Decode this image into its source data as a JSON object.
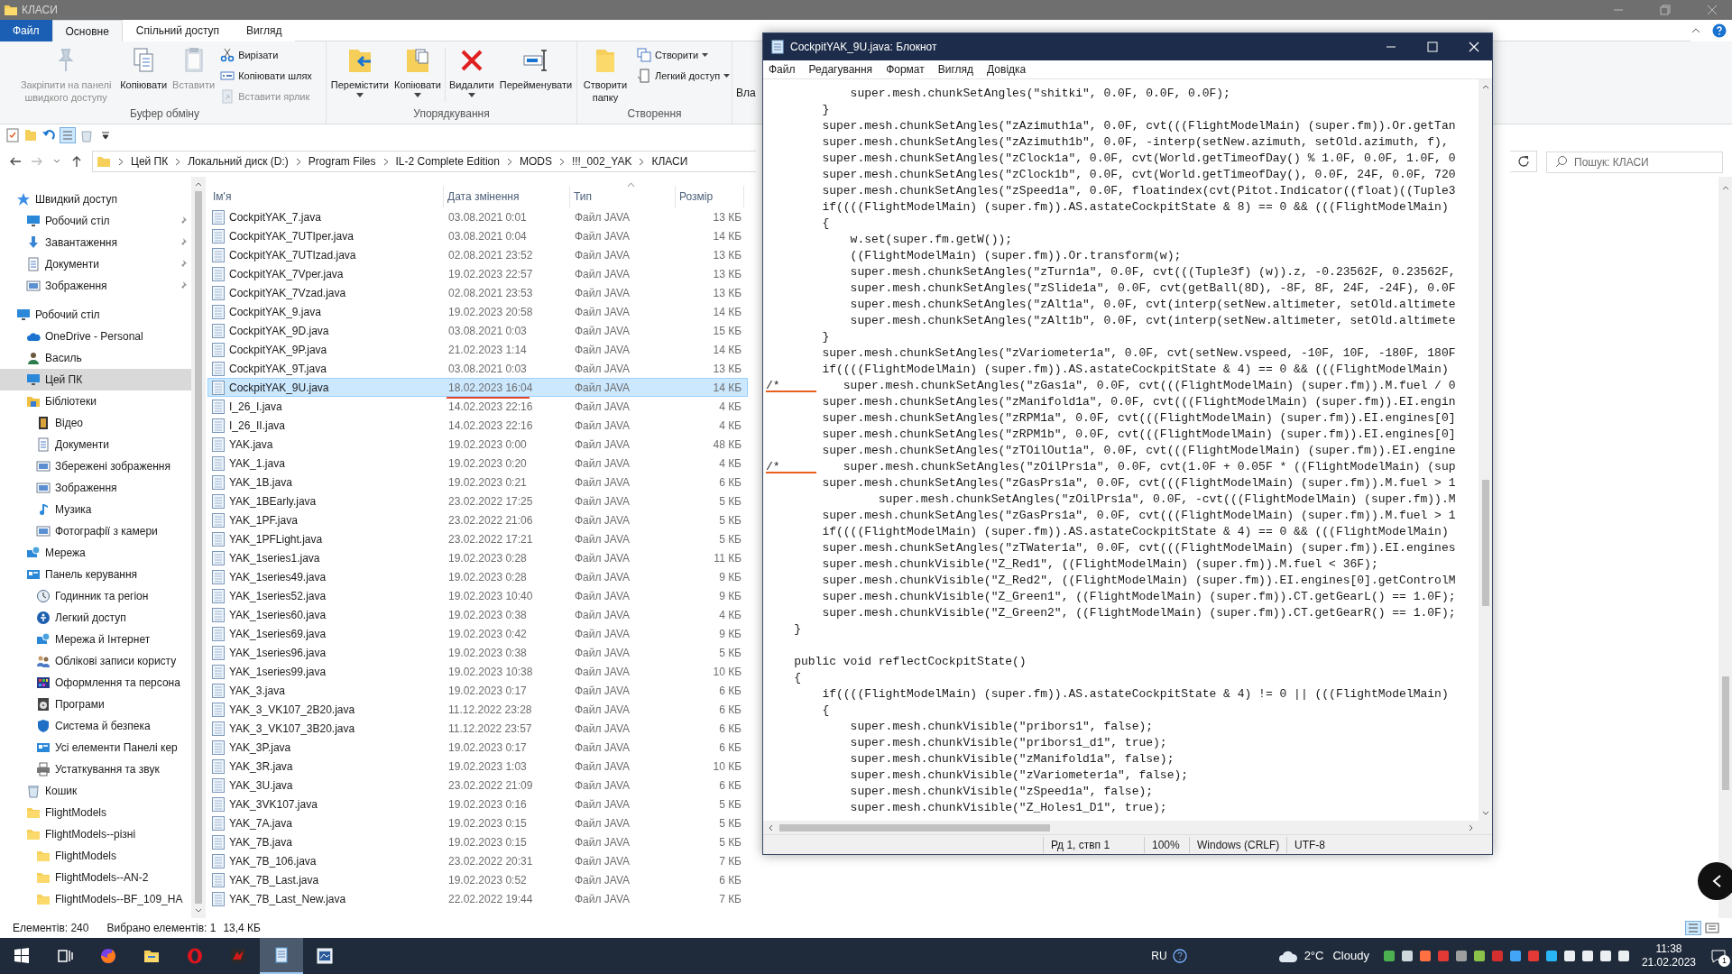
{
  "explorer": {
    "title": "КЛАСИ",
    "tabs": [
      {
        "label": "Файл",
        "kind": "file",
        "selected": false
      },
      {
        "label": "Основне",
        "kind": "tab",
        "selected": true
      },
      {
        "label": "Спільний доступ",
        "kind": "tab",
        "selected": false
      },
      {
        "label": "Вигляд",
        "kind": "tab",
        "selected": false
      }
    ],
    "ribbon": [
      {
        "label": "Буфер обміну",
        "large": [
          {
            "label": "Закріпити на панелі швидкого доступу",
            "disabled": true,
            "dropdown": false
          },
          {
            "label": "Копіювати",
            "disabled": false,
            "dropdown": false
          },
          {
            "label": "Вставити",
            "disabled": true,
            "dropdown": false
          }
        ],
        "small": [
          {
            "label": "Вирізати",
            "disabled": false,
            "dropdown": false
          },
          {
            "label": "Копіювати шлях",
            "disabled": false,
            "dropdown": false
          },
          {
            "label": "Вставити ярлик",
            "disabled": true,
            "dropdown": false
          }
        ]
      },
      {
        "label": "Упорядкування",
        "large": [
          {
            "label": "Перемістити",
            "disabled": false,
            "dropdown": true
          },
          {
            "label": "Копіювати",
            "disabled": false,
            "dropdown": true
          },
          {
            "label": "Видалити",
            "disabled": false,
            "dropdown": true
          },
          {
            "label": "Перейменувати",
            "disabled": false,
            "dropdown": false
          }
        ]
      },
      {
        "label": "Створення",
        "large": [
          {
            "label": "Створити папку",
            "disabled": false,
            "dropdown": false
          }
        ],
        "small": [
          {
            "label": "Створити",
            "disabled": false,
            "dropdown": true
          },
          {
            "label": "Легкий доступ",
            "disabled": false,
            "dropdown": true
          }
        ]
      }
    ],
    "ribbon_clipped_label": "Вла",
    "breadcrumbs": [
      "Цей ПК",
      "Локальний диск (D:)",
      "Program Files",
      "IL-2 Complete Edition",
      "MODS",
      "!!!_002_YAK",
      "КЛАСИ"
    ],
    "search": {
      "placeholder": "Пошук: КЛАСИ"
    },
    "sidebar": [
      {
        "label": "Швидкий доступ",
        "selected": false,
        "children": [
          {
            "label": "Робочий стіл",
            "selected": false,
            "pinned": true
          },
          {
            "label": "Завантаження",
            "selected": false,
            "pinned": true
          },
          {
            "label": "Документи",
            "selected": false,
            "pinned": true
          },
          {
            "label": "Зображення",
            "selected": false,
            "pinned": true
          }
        ]
      },
      {
        "label": "Робочий стіл",
        "selected": false,
        "children": [
          {
            "label": "OneDrive - Personal",
            "selected": false
          },
          {
            "label": "Василь",
            "selected": false
          },
          {
            "label": "Цей ПК",
            "selected": true
          },
          {
            "label": "Бібліотеки",
            "selected": false,
            "children": [
              {
                "label": "Відео",
                "selected": false
              },
              {
                "label": "Документи",
                "selected": false
              },
              {
                "label": "Збережені зображення",
                "selected": false
              },
              {
                "label": "Зображення",
                "selected": false
              },
              {
                "label": "Музика",
                "selected": false
              },
              {
                "label": "Фотографії з камери",
                "selected": false
              }
            ]
          },
          {
            "label": "Мережа",
            "selected": false
          },
          {
            "label": "Панель керування",
            "selected": false,
            "children": [
              {
                "label": "Годинник та регіон",
                "selected": false
              },
              {
                "label": "Легкий доступ",
                "selected": false
              },
              {
                "label": "Мережа й Інтернет",
                "selected": false
              },
              {
                "label": "Облікові записи користу",
                "selected": false
              },
              {
                "label": "Оформлення та персона",
                "selected": false
              },
              {
                "label": "Програми",
                "selected": false
              },
              {
                "label": "Система й безпека",
                "selected": false
              },
              {
                "label": "Усі елементи Панелі кер",
                "selected": false
              },
              {
                "label": "Устаткування та звук",
                "selected": false
              }
            ]
          },
          {
            "label": "Кошик",
            "selected": false
          },
          {
            "label": "FlightModels",
            "selected": false
          },
          {
            "label": "FlightModels--різні",
            "selected": false,
            "children": [
              {
                "label": "FlightModels",
                "selected": false
              },
              {
                "label": "FlightModels--AN-2",
                "selected": false
              },
              {
                "label": "FlightModels--BF_109_HA",
                "selected": false
              }
            ]
          }
        ]
      }
    ],
    "columns": [
      "Ім'я",
      "Дата змінення",
      "Тип",
      "Розмір"
    ],
    "files": [
      {
        "name": "CockpitYAK_7.java",
        "modified": "03.08.2021 0:01",
        "type": "Файл JAVA",
        "size": "13 КБ",
        "selected": false,
        "underlined": false
      },
      {
        "name": "CockpitYAK_7UTIper.java",
        "modified": "03.08.2021 0:04",
        "type": "Файл JAVA",
        "size": "14 КБ",
        "selected": false,
        "underlined": false
      },
      {
        "name": "CockpitYAK_7UTIzad.java",
        "modified": "02.08.2021 23:52",
        "type": "Файл JAVA",
        "size": "13 КБ",
        "selected": false,
        "underlined": false
      },
      {
        "name": "CockpitYAK_7Vper.java",
        "modified": "19.02.2023 22:57",
        "type": "Файл JAVA",
        "size": "13 КБ",
        "selected": false,
        "underlined": false
      },
      {
        "name": "CockpitYAK_7Vzad.java",
        "modified": "02.08.2021 23:53",
        "type": "Файл JAVA",
        "size": "13 КБ",
        "selected": false,
        "underlined": false
      },
      {
        "name": "CockpitYAK_9.java",
        "modified": "19.02.2023 20:58",
        "type": "Файл JAVA",
        "size": "14 КБ",
        "selected": false,
        "underlined": false
      },
      {
        "name": "CockpitYAK_9D.java",
        "modified": "03.08.2021 0:03",
        "type": "Файл JAVA",
        "size": "15 КБ",
        "selected": false,
        "underlined": false
      },
      {
        "name": "CockpitYAK_9P.java",
        "modified": "21.02.2023 1:14",
        "type": "Файл JAVA",
        "size": "14 КБ",
        "selected": false,
        "underlined": false
      },
      {
        "name": "CockpitYAK_9T.java",
        "modified": "03.08.2021 0:03",
        "type": "Файл JAVA",
        "size": "13 КБ",
        "selected": false,
        "underlined": false
      },
      {
        "name": "CockpitYAK_9U.java",
        "modified": "18.02.2023 16:04",
        "type": "Файл JAVA",
        "size": "14 КБ",
        "selected": true,
        "underlined": true
      },
      {
        "name": "I_26_I.java",
        "modified": "14.02.2023 22:16",
        "type": "Файл JAVA",
        "size": "4 КБ",
        "selected": false,
        "underlined": false
      },
      {
        "name": "I_26_II.java",
        "modified": "14.02.2023 22:16",
        "type": "Файл JAVA",
        "size": "4 КБ",
        "selected": false,
        "underlined": false
      },
      {
        "name": "YAK.java",
        "modified": "19.02.2023 0:00",
        "type": "Файл JAVA",
        "size": "48 КБ",
        "selected": false,
        "underlined": false
      },
      {
        "name": "YAK_1.java",
        "modified": "19.02.2023 0:20",
        "type": "Файл JAVA",
        "size": "4 КБ",
        "selected": false,
        "underlined": false
      },
      {
        "name": "YAK_1B.java",
        "modified": "19.02.2023 0:21",
        "type": "Файл JAVA",
        "size": "6 КБ",
        "selected": false,
        "underlined": false
      },
      {
        "name": "YAK_1BEarly.java",
        "modified": "23.02.2022 17:25",
        "type": "Файл JAVA",
        "size": "5 КБ",
        "selected": false,
        "underlined": false
      },
      {
        "name": "YAK_1PF.java",
        "modified": "23.02.2022 21:06",
        "type": "Файл JAVA",
        "size": "5 КБ",
        "selected": false,
        "underlined": false
      },
      {
        "name": "YAK_1PFLight.java",
        "modified": "23.02.2022 17:21",
        "type": "Файл JAVA",
        "size": "5 КБ",
        "selected": false,
        "underlined": false
      },
      {
        "name": "YAK_1series1.java",
        "modified": "19.02.2023 0:28",
        "type": "Файл JAVA",
        "size": "11 КБ",
        "selected": false,
        "underlined": false
      },
      {
        "name": "YAK_1series49.java",
        "modified": "19.02.2023 0:28",
        "type": "Файл JAVA",
        "size": "9 КБ",
        "selected": false,
        "underlined": false
      },
      {
        "name": "YAK_1series52.java",
        "modified": "19.02.2023 10:40",
        "type": "Файл JAVA",
        "size": "9 КБ",
        "selected": false,
        "underlined": false
      },
      {
        "name": "YAK_1series60.java",
        "modified": "19.02.2023 0:38",
        "type": "Файл JAVA",
        "size": "4 КБ",
        "selected": false,
        "underlined": false
      },
      {
        "name": "YAK_1series69.java",
        "modified": "19.02.2023 0:42",
        "type": "Файл JAVA",
        "size": "9 КБ",
        "selected": false,
        "underlined": false
      },
      {
        "name": "YAK_1series96.java",
        "modified": "19.02.2023 0:38",
        "type": "Файл JAVA",
        "size": "5 КБ",
        "selected": false,
        "underlined": false
      },
      {
        "name": "YAK_1series99.java",
        "modified": "19.02.2023 10:38",
        "type": "Файл JAVA",
        "size": "10 КБ",
        "selected": false,
        "underlined": false
      },
      {
        "name": "YAK_3.java",
        "modified": "19.02.2023 0:17",
        "type": "Файл JAVA",
        "size": "6 КБ",
        "selected": false,
        "underlined": false
      },
      {
        "name": "YAK_3_VK107_2B20.java",
        "modified": "11.12.2022 23:28",
        "type": "Файл JAVA",
        "size": "6 КБ",
        "selected": false,
        "underlined": false
      },
      {
        "name": "YAK_3_VK107_3B20.java",
        "modified": "11.12.2022 23:57",
        "type": "Файл JAVA",
        "size": "6 КБ",
        "selected": false,
        "underlined": false
      },
      {
        "name": "YAK_3P.java",
        "modified": "19.02.2023 0:17",
        "type": "Файл JAVA",
        "size": "6 КБ",
        "selected": false,
        "underlined": false
      },
      {
        "name": "YAK_3R.java",
        "modified": "19.02.2023 1:03",
        "type": "Файл JAVA",
        "size": "10 КБ",
        "selected": false,
        "underlined": false
      },
      {
        "name": "YAK_3U.java",
        "modified": "23.02.2022 21:09",
        "type": "Файл JAVA",
        "size": "6 КБ",
        "selected": false,
        "underlined": false
      },
      {
        "name": "YAK_3VK107.java",
        "modified": "19.02.2023 0:16",
        "type": "Файл JAVA",
        "size": "5 КБ",
        "selected": false,
        "underlined": false
      },
      {
        "name": "YAK_7A.java",
        "modified": "19.02.2023 0:15",
        "type": "Файл JAVA",
        "size": "5 КБ",
        "selected": false,
        "underlined": false
      },
      {
        "name": "YAK_7B.java",
        "modified": "19.02.2023 0:15",
        "type": "Файл JAVA",
        "size": "5 КБ",
        "selected": false,
        "underlined": false
      },
      {
        "name": "YAK_7B_106.java",
        "modified": "23.02.2022 20:31",
        "type": "Файл JAVA",
        "size": "7 КБ",
        "selected": false,
        "underlined": false
      },
      {
        "name": "YAK_7B_Last.java",
        "modified": "19.02.2023 0:52",
        "type": "Файл JAVA",
        "size": "6 КБ",
        "selected": false,
        "underlined": false
      },
      {
        "name": "YAK_7B_Last_New.java",
        "modified": "22.02.2022 19:44",
        "type": "Файл JAVA",
        "size": "7 КБ",
        "selected": false,
        "underlined": false
      }
    ],
    "status": {
      "item_count": "Елементів: 240",
      "selection": "Вибрано елементів: 1",
      "selection_size": "13,4 КБ"
    }
  },
  "notepad": {
    "title": "CockpitYAK_9U.java: Блокнот",
    "menu": [
      "Файл",
      "Редагування",
      "Формат",
      "Вигляд",
      "Довідка"
    ],
    "lines": [
      {
        "kind": "code",
        "text": "            super.mesh.chunkSetAngles(\"shitki\", 0.0F, 0.0F, 0.0F);",
        "underlined": false
      },
      {
        "kind": "code",
        "text": "        }",
        "underlined": false
      },
      {
        "kind": "code",
        "text": "        super.mesh.chunkSetAngles(\"zAzimuth1a\", 0.0F, cvt(((FlightModelMain) (super.fm)).Or.getTan",
        "underlined": false
      },
      {
        "kind": "code",
        "text": "        super.mesh.chunkSetAngles(\"zAzimuth1b\", 0.0F, -interp(setNew.azimuth, setOld.azimuth, f),",
        "underlined": false
      },
      {
        "kind": "code",
        "text": "        super.mesh.chunkSetAngles(\"zClock1a\", 0.0F, cvt(World.getTimeofDay() % 1.0F, 0.0F, 1.0F, 0",
        "underlined": false
      },
      {
        "kind": "code",
        "text": "        super.mesh.chunkSetAngles(\"zClock1b\", 0.0F, cvt(World.getTimeofDay(), 0.0F, 24F, 0.0F, 720",
        "underlined": false
      },
      {
        "kind": "code",
        "text": "        super.mesh.chunkSetAngles(\"zSpeed1a\", 0.0F, floatindex(cvt(Pitot.Indicator((float)((Tuple3",
        "underlined": false
      },
      {
        "kind": "code",
        "text": "        if((((FlightModelMain) (super.fm)).AS.astateCockpitState & 8) == 0 && (((FlightModelMain)",
        "underlined": false
      },
      {
        "kind": "code",
        "text": "        {",
        "underlined": false
      },
      {
        "kind": "code",
        "text": "            w.set(super.fm.getW());",
        "underlined": false
      },
      {
        "kind": "code",
        "text": "            ((FlightModelMain) (super.fm)).Or.transform(w);",
        "underlined": false
      },
      {
        "kind": "code",
        "text": "            super.mesh.chunkSetAngles(\"zTurn1a\", 0.0F, cvt(((Tuple3f) (w)).z, -0.23562F, 0.23562F,",
        "underlined": false
      },
      {
        "kind": "code",
        "text": "            super.mesh.chunkSetAngles(\"zSlide1a\", 0.0F, cvt(getBall(8D), -8F, 8F, 24F, -24F), 0.0F",
        "underlined": false
      },
      {
        "kind": "code",
        "text": "            super.mesh.chunkSetAngles(\"zAlt1a\", 0.0F, cvt(interp(setNew.altimeter, setOld.altimete",
        "underlined": false
      },
      {
        "kind": "code",
        "text": "            super.mesh.chunkSetAngles(\"zAlt1b\", 0.0F, cvt(interp(setNew.altimeter, setOld.altimete",
        "underlined": false
      },
      {
        "kind": "code",
        "text": "        }",
        "underlined": false
      },
      {
        "kind": "code",
        "text": "        super.mesh.chunkSetAngles(\"zVariometer1a\", 0.0F, cvt(setNew.vspeed, -10F, 10F, -180F, 180F",
        "underlined": false
      },
      {
        "kind": "code",
        "text": "        if((((FlightModelMain) (super.fm)).AS.astateCockpitState & 4) == 0 && (((FlightModelMain)",
        "underlined": false
      },
      {
        "kind": "code",
        "text": "/*         super.mesh.chunkSetAngles(\"zGas1a\", 0.0F, cvt(((FlightModelMain) (super.fm)).M.fuel / 0",
        "underlined": true
      },
      {
        "kind": "code",
        "text": "        super.mesh.chunkSetAngles(\"zManifold1a\", 0.0F, cvt(((FlightModelMain) (super.fm)).EI.engin",
        "underlined": false
      },
      {
        "kind": "code",
        "text": "        super.mesh.chunkSetAngles(\"zRPM1a\", 0.0F, cvt(((FlightModelMain) (super.fm)).EI.engines[0]",
        "underlined": false
      },
      {
        "kind": "code",
        "text": "        super.mesh.chunkSetAngles(\"zRPM1b\", 0.0F, cvt(((FlightModelMain) (super.fm)).EI.engines[0]",
        "underlined": false
      },
      {
        "kind": "code",
        "text": "        super.mesh.chunkSetAngles(\"zTOilOut1a\", 0.0F, cvt(((FlightModelMain) (super.fm)).EI.engine",
        "underlined": false
      },
      {
        "kind": "code",
        "text": "/*         super.mesh.chunkSetAngles(\"zOilPrs1a\", 0.0F, cvt(1.0F + 0.05F * ((FlightModelMain) (sup",
        "underlined": true
      },
      {
        "kind": "code",
        "text": "        super.mesh.chunkSetAngles(\"zGasPrs1a\", 0.0F, cvt(((FlightModelMain) (super.fm)).M.fuel > 1",
        "underlined": false
      },
      {
        "kind": "code",
        "text": "                super.mesh.chunkSetAngles(\"zOilPrs1a\", 0.0F, -cvt(((FlightModelMain) (super.fm)).M",
        "underlined": false
      },
      {
        "kind": "code",
        "text": "        super.mesh.chunkSetAngles(\"zGasPrs1a\", 0.0F, cvt(((FlightModelMain) (super.fm)).M.fuel > 1",
        "underlined": false
      },
      {
        "kind": "code",
        "text": "        if((((FlightModelMain) (super.fm)).AS.astateCockpitState & 4) == 0 && (((FlightModelMain)",
        "underlined": false
      },
      {
        "kind": "code",
        "text": "        super.mesh.chunkSetAngles(\"zTWater1a\", 0.0F, cvt(((FlightModelMain) (super.fm)).EI.engines",
        "underlined": false
      },
      {
        "kind": "code",
        "text": "        super.mesh.chunkVisible(\"Z_Red1\", ((FlightModelMain) (super.fm)).M.fuel < 36F);",
        "underlined": false
      },
      {
        "kind": "code",
        "text": "        super.mesh.chunkVisible(\"Z_Red2\", ((FlightModelMain) (super.fm)).EI.engines[0].getControlM",
        "underlined": false
      },
      {
        "kind": "code",
        "text": "        super.mesh.chunkVisible(\"Z_Green1\", ((FlightModelMain) (super.fm)).CT.getGearL() == 1.0F);",
        "underlined": false
      },
      {
        "kind": "code",
        "text": "        super.mesh.chunkVisible(\"Z_Green2\", ((FlightModelMain) (super.fm)).CT.getGearR() == 1.0F);",
        "underlined": false
      },
      {
        "kind": "code",
        "text": "    }",
        "underlined": false
      },
      {
        "kind": "blank"
      },
      {
        "kind": "code",
        "text": "    public void reflectCockpitState()",
        "underlined": false
      },
      {
        "kind": "code",
        "text": "    {",
        "underlined": false
      },
      {
        "kind": "code",
        "text": "        if((((FlightModelMain) (super.fm)).AS.astateCockpitState & 4) != 0 || (((FlightModelMain)",
        "underlined": false
      },
      {
        "kind": "code",
        "text": "        {",
        "underlined": false
      },
      {
        "kind": "code",
        "text": "            super.mesh.chunkVisible(\"pribors1\", false);",
        "underlined": false
      },
      {
        "kind": "code",
        "text": "            super.mesh.chunkVisible(\"pribors1_d1\", true);",
        "underlined": false
      },
      {
        "kind": "code",
        "text": "            super.mesh.chunkVisible(\"zManifold1a\", false);",
        "underlined": false
      },
      {
        "kind": "code",
        "text": "            super.mesh.chunkVisible(\"zVariometer1a\", false);",
        "underlined": false
      },
      {
        "kind": "code",
        "text": "            super.mesh.chunkVisible(\"zSpeed1a\", false);",
        "underlined": false
      },
      {
        "kind": "code",
        "text": "            super.mesh.chunkVisible(\"Z_Holes1_D1\", true);",
        "underlined": false
      }
    ],
    "status": {
      "position": "Рд 1, ствп 1",
      "zoom": "100%",
      "line_ending": "Windows (CRLF)",
      "encoding": "UTF-8"
    }
  },
  "taskbar": {
    "apps": [
      {
        "selected": false
      },
      {
        "selected": false
      },
      {
        "selected": false
      },
      {
        "selected": false
      },
      {
        "selected": false
      },
      {
        "selected": true
      },
      {
        "selected": false
      }
    ],
    "language": "RU",
    "temperature": "2°C",
    "weather": "Cloudy",
    "time": "11:38",
    "date": "21.02.2023",
    "notifications": "1"
  }
}
